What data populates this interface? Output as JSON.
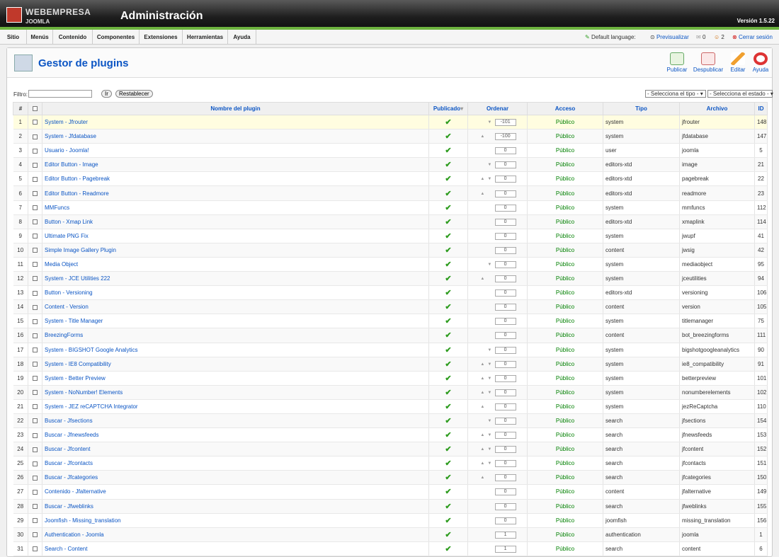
{
  "header": {
    "brand": "WEBEMPRESA",
    "brand_sub": "JOOMLA",
    "title": "Administración",
    "version": "Versión 1.5.22"
  },
  "menu": [
    "Sitio",
    "Menús",
    "Contenido",
    "Componentes",
    "Extensiones",
    "Herramientas",
    "Ayuda"
  ],
  "status": {
    "language_label": "Default language:",
    "preview": "Previsualizar",
    "messages": "0",
    "users": "2",
    "logout": "Cerrar sesión"
  },
  "toolbar": {
    "title": "Gestor de plugins",
    "publish": "Publicar",
    "unpublish": "Despublicar",
    "edit": "Editar",
    "help": "Ayuda"
  },
  "filter": {
    "label": "Filtro:",
    "go": "Ir",
    "reset": "Restablecer",
    "type_select": "- Selecciona el tipo -",
    "state_select": "- Selecciona el estado -"
  },
  "columns": [
    "#",
    "",
    "Nombre del plugin",
    "Publicado",
    "Ordenar",
    "Acceso",
    "Tipo",
    "Archivo",
    "ID"
  ],
  "rows": [
    {
      "n": "1",
      "name": "System - Jfrouter",
      "up": false,
      "down": true,
      "order": "-101",
      "access": "Público",
      "type": "system",
      "file": "jfrouter",
      "id": "148"
    },
    {
      "n": "2",
      "name": "System - Jfdatabase",
      "up": true,
      "down": false,
      "order": "-100",
      "access": "Público",
      "type": "system",
      "file": "jfdatabase",
      "id": "147"
    },
    {
      "n": "3",
      "name": "Usuario - Joomla!",
      "up": false,
      "down": false,
      "order": "0",
      "access": "Público",
      "type": "user",
      "file": "joomla",
      "id": "5"
    },
    {
      "n": "4",
      "name": "Editor Button - Image",
      "up": false,
      "down": true,
      "order": "0",
      "access": "Público",
      "type": "editors-xtd",
      "file": "image",
      "id": "21"
    },
    {
      "n": "5",
      "name": "Editor Button - Pagebreak",
      "up": true,
      "down": true,
      "order": "0",
      "access": "Público",
      "type": "editors-xtd",
      "file": "pagebreak",
      "id": "22"
    },
    {
      "n": "6",
      "name": "Editor Button - Readmore",
      "up": true,
      "down": false,
      "order": "0",
      "access": "Público",
      "type": "editors-xtd",
      "file": "readmore",
      "id": "23"
    },
    {
      "n": "7",
      "name": "MMFuncs",
      "up": false,
      "down": false,
      "order": "0",
      "access": "Público",
      "type": "system",
      "file": "mmfuncs",
      "id": "112"
    },
    {
      "n": "8",
      "name": "Button - Xmap Link",
      "up": false,
      "down": false,
      "order": "0",
      "access": "Público",
      "type": "editors-xtd",
      "file": "xmaplink",
      "id": "114"
    },
    {
      "n": "9",
      "name": "Ultimate PNG Fix",
      "up": false,
      "down": false,
      "order": "0",
      "access": "Público",
      "type": "system",
      "file": "jwupf",
      "id": "41"
    },
    {
      "n": "10",
      "name": "Simple Image Gallery Plugin",
      "up": false,
      "down": false,
      "order": "0",
      "access": "Público",
      "type": "content",
      "file": "jwsig",
      "id": "42"
    },
    {
      "n": "11",
      "name": "Media Object",
      "up": false,
      "down": true,
      "order": "0",
      "access": "Público",
      "type": "system",
      "file": "mediaobject",
      "id": "95"
    },
    {
      "n": "12",
      "name": "System - JCE Utilities 222",
      "up": true,
      "down": false,
      "order": "0",
      "access": "Público",
      "type": "system",
      "file": "jceutilities",
      "id": "94"
    },
    {
      "n": "13",
      "name": "Button - Versioning",
      "up": false,
      "down": false,
      "order": "0",
      "access": "Público",
      "type": "editors-xtd",
      "file": "versioning",
      "id": "106"
    },
    {
      "n": "14",
      "name": "Content - Version",
      "up": false,
      "down": false,
      "order": "0",
      "access": "Público",
      "type": "content",
      "file": "version",
      "id": "105"
    },
    {
      "n": "15",
      "name": "System - Title Manager",
      "up": false,
      "down": false,
      "order": "0",
      "access": "Público",
      "type": "system",
      "file": "titlemanager",
      "id": "75"
    },
    {
      "n": "16",
      "name": "BreezingForms",
      "up": false,
      "down": false,
      "order": "0",
      "access": "Público",
      "type": "content",
      "file": "bot_breezingforms",
      "id": "111"
    },
    {
      "n": "17",
      "name": "System - BIGSHOT Google Analytics",
      "up": false,
      "down": true,
      "order": "0",
      "access": "Público",
      "type": "system",
      "file": "bigshotgoogleanalytics",
      "id": "90"
    },
    {
      "n": "18",
      "name": "System - IE8 Compatibility",
      "up": true,
      "down": true,
      "order": "0",
      "access": "Público",
      "type": "system",
      "file": "ie8_compatibility",
      "id": "91"
    },
    {
      "n": "19",
      "name": "System - Better Preview",
      "up": true,
      "down": true,
      "order": "0",
      "access": "Público",
      "type": "system",
      "file": "betterpreview",
      "id": "101"
    },
    {
      "n": "20",
      "name": "System - NoNumber! Elements",
      "up": true,
      "down": true,
      "order": "0",
      "access": "Público",
      "type": "system",
      "file": "nonumberelements",
      "id": "102"
    },
    {
      "n": "21",
      "name": "System - JEZ reCAPTCHA Integrator",
      "up": true,
      "down": false,
      "order": "0",
      "access": "Público",
      "type": "system",
      "file": "jezReCaptcha",
      "id": "110"
    },
    {
      "n": "22",
      "name": "Buscar - Jfsections",
      "up": false,
      "down": true,
      "order": "0",
      "access": "Público",
      "type": "search",
      "file": "jfsections",
      "id": "154"
    },
    {
      "n": "23",
      "name": "Buscar - Jfnewsfeeds",
      "up": true,
      "down": true,
      "order": "0",
      "access": "Público",
      "type": "search",
      "file": "jfnewsfeeds",
      "id": "153"
    },
    {
      "n": "24",
      "name": "Buscar - Jfcontent",
      "up": true,
      "down": true,
      "order": "0",
      "access": "Público",
      "type": "search",
      "file": "jfcontent",
      "id": "152"
    },
    {
      "n": "25",
      "name": "Buscar - Jfcontacts",
      "up": true,
      "down": true,
      "order": "0",
      "access": "Público",
      "type": "search",
      "file": "jfcontacts",
      "id": "151"
    },
    {
      "n": "26",
      "name": "Buscar - Jfcategories",
      "up": true,
      "down": false,
      "order": "0",
      "access": "Público",
      "type": "search",
      "file": "jfcategories",
      "id": "150"
    },
    {
      "n": "27",
      "name": "Contenido - Jfalternative",
      "up": false,
      "down": false,
      "order": "0",
      "access": "Público",
      "type": "content",
      "file": "jfalternative",
      "id": "149"
    },
    {
      "n": "28",
      "name": "Buscar - Jfweblinks",
      "up": false,
      "down": false,
      "order": "0",
      "access": "Público",
      "type": "search",
      "file": "jfweblinks",
      "id": "155"
    },
    {
      "n": "29",
      "name": "Joomfish - Missing_translation",
      "up": false,
      "down": false,
      "order": "0",
      "access": "Público",
      "type": "joomfish",
      "file": "missing_translation",
      "id": "156"
    },
    {
      "n": "30",
      "name": "Authentication - Joomla",
      "up": false,
      "down": false,
      "order": "1",
      "access": "Público",
      "type": "authentication",
      "file": "joomla",
      "id": "1"
    },
    {
      "n": "31",
      "name": "Search - Content",
      "up": false,
      "down": false,
      "order": "1",
      "access": "Público",
      "type": "search",
      "file": "content",
      "id": "6"
    }
  ]
}
